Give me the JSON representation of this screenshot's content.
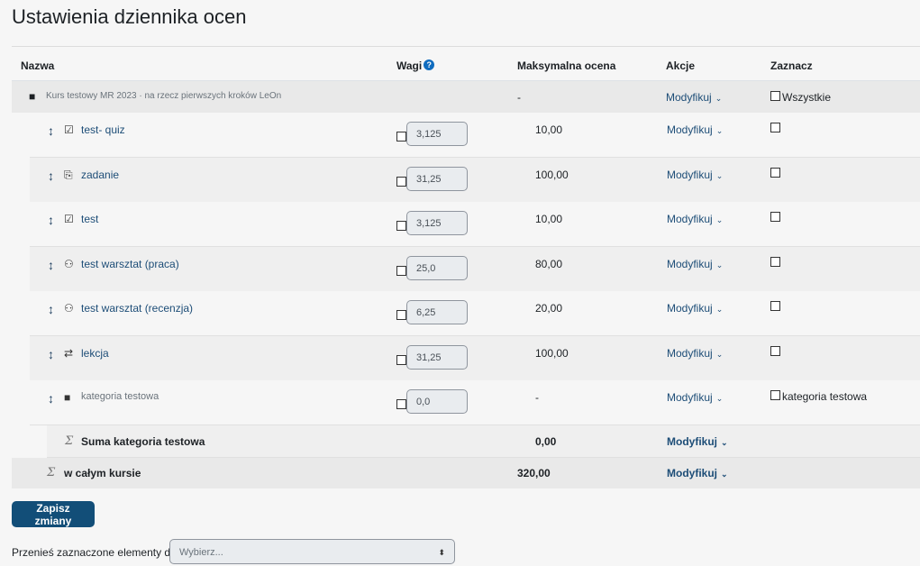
{
  "title": "Ustawienia dziennika ocen",
  "headers": {
    "name": "Nazwa",
    "weights": "Wagi",
    "max": "Maksymalna ocena",
    "actions": "Akcje",
    "select": "Zaznacz"
  },
  "course": {
    "name": "Kurs testowy MR 2023 · na rzecz pierwszych kroków LeOn",
    "max": "-",
    "action": "Modyfikuj",
    "select_label": "Wszystkie"
  },
  "items": [
    {
      "icon": "quiz-icon",
      "glyph": "☑",
      "name": "test- quiz",
      "weight": "3,125",
      "max": "10,00",
      "action": "Modyfikuj"
    },
    {
      "icon": "assignment-icon",
      "glyph": "⎘",
      "name": "zadanie",
      "weight": "31,25",
      "max": "100,00",
      "action": "Modyfikuj"
    },
    {
      "icon": "quiz-icon",
      "glyph": "☑",
      "name": "test",
      "weight": "3,125",
      "max": "10,00",
      "action": "Modyfikuj"
    },
    {
      "icon": "workshop-icon",
      "glyph": "⚇",
      "name": "test warsztat (praca)",
      "weight": "25,0",
      "max": "80,00",
      "action": "Modyfikuj"
    },
    {
      "icon": "workshop-icon",
      "glyph": "⚇",
      "name": "test warsztat (recenzja)",
      "weight": "6,25",
      "max": "20,00",
      "action": "Modyfikuj"
    },
    {
      "icon": "lesson-icon",
      "glyph": "⇄",
      "name": "lekcja",
      "weight": "31,25",
      "max": "100,00",
      "action": "Modyfikuj"
    },
    {
      "icon": "folder-icon",
      "glyph": "■",
      "name": "kategoria testowa",
      "weight": "0,0",
      "max": "-",
      "action": "Modyfikuj",
      "select_label": "kategoria testowa"
    }
  ],
  "category_total": {
    "name": "Suma kategoria testowa",
    "max": "0,00",
    "action": "Modyfikuj"
  },
  "course_total": {
    "name": "w całym kursie",
    "max": "320,00",
    "action": "Modyfikuj"
  },
  "save_button": "Zapisz zmiany",
  "move_label": "Przenieś zaznaczone elementy do",
  "move_select": "Wybierz..."
}
